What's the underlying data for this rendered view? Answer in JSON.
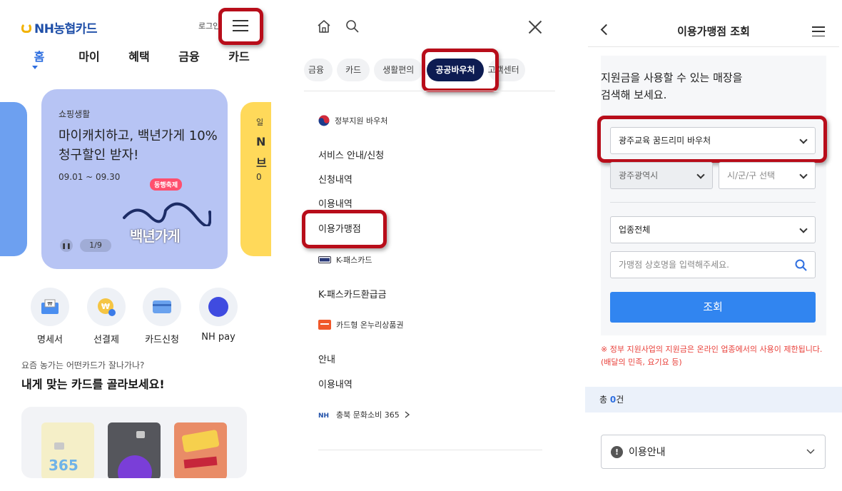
{
  "panel1": {
    "logo": "NH농협카드",
    "login": "로그인",
    "nav": [
      "홈",
      "마이",
      "혜택",
      "금융",
      "카드"
    ],
    "banner": {
      "category": "쇼핑생활",
      "title": "마이캐치하고, 백년가게 10% 청구할인 받자!",
      "date": "09.01 ~ 09.30",
      "badge": "동행축제",
      "brand": "백년가게",
      "pause_icon": "pause-icon",
      "page": "1/9"
    },
    "side_right_text": [
      "일",
      "N",
      "브",
      "0"
    ],
    "quick_actions": [
      {
        "label": "명세서",
        "icon": "statement-icon"
      },
      {
        "label": "선결제",
        "icon": "won-coin-icon"
      },
      {
        "label": "카드신청",
        "icon": "card-icon"
      },
      {
        "label": "NH pay",
        "icon": "nh-pay-icon"
      }
    ],
    "recommend_q": "요즘 농가는 어떤카드가 잘나가나?",
    "recommend_h": "내게 맞는 카드를 골라보세요!",
    "mini_card_text": "365"
  },
  "panel2": {
    "chips": [
      "금융",
      "카드",
      "생활편의",
      "공공바우처",
      "고객센터"
    ],
    "active_chip": "공공바우처",
    "sections": [
      {
        "header": "정부지원 바우처",
        "icon": "korea-gov-icon",
        "items": [
          "서비스 안내/신청",
          "신청내역",
          "이용내역",
          "이용가맹점"
        ]
      },
      {
        "header": "K-패스카드",
        "icon": "kpass-icon",
        "items": [
          "K-패스카드환급금"
        ]
      },
      {
        "header": "카드형 온누리상품권",
        "icon": "onnuri-icon",
        "items": [
          "안내",
          "이용내역"
        ]
      },
      {
        "header": "충북 문화소비 365",
        "icon": "nh-icon",
        "items": []
      }
    ]
  },
  "panel3": {
    "title": "이용가맹점 조회",
    "lead": [
      "지원금을 사용할 수 있는 매장을",
      "검색해 보세요."
    ],
    "voucher_select": "광주교육 꿈드리미 바우처",
    "region_select": "광주광역시",
    "district_select": "시/군/구 선택",
    "category_select": "업종전체",
    "search_placeholder": "가맹점 상호명을 입력해주세요.",
    "search_button": "조회",
    "notice": [
      "※ 정부 지원사업의 지원금은 온라인 업종에서의 사용이 제한됩니다.",
      "(배달의 민족, 요기요 등)"
    ],
    "count_prefix": "총 ",
    "count_value": "0",
    "count_suffix": "건",
    "usage_label": "이용안내"
  },
  "colors": {
    "accent_blue": "#3185f0",
    "brand_navy": "#0d1c52",
    "highlight_red": "#b80d1a",
    "notice_red": "#e9413b"
  }
}
